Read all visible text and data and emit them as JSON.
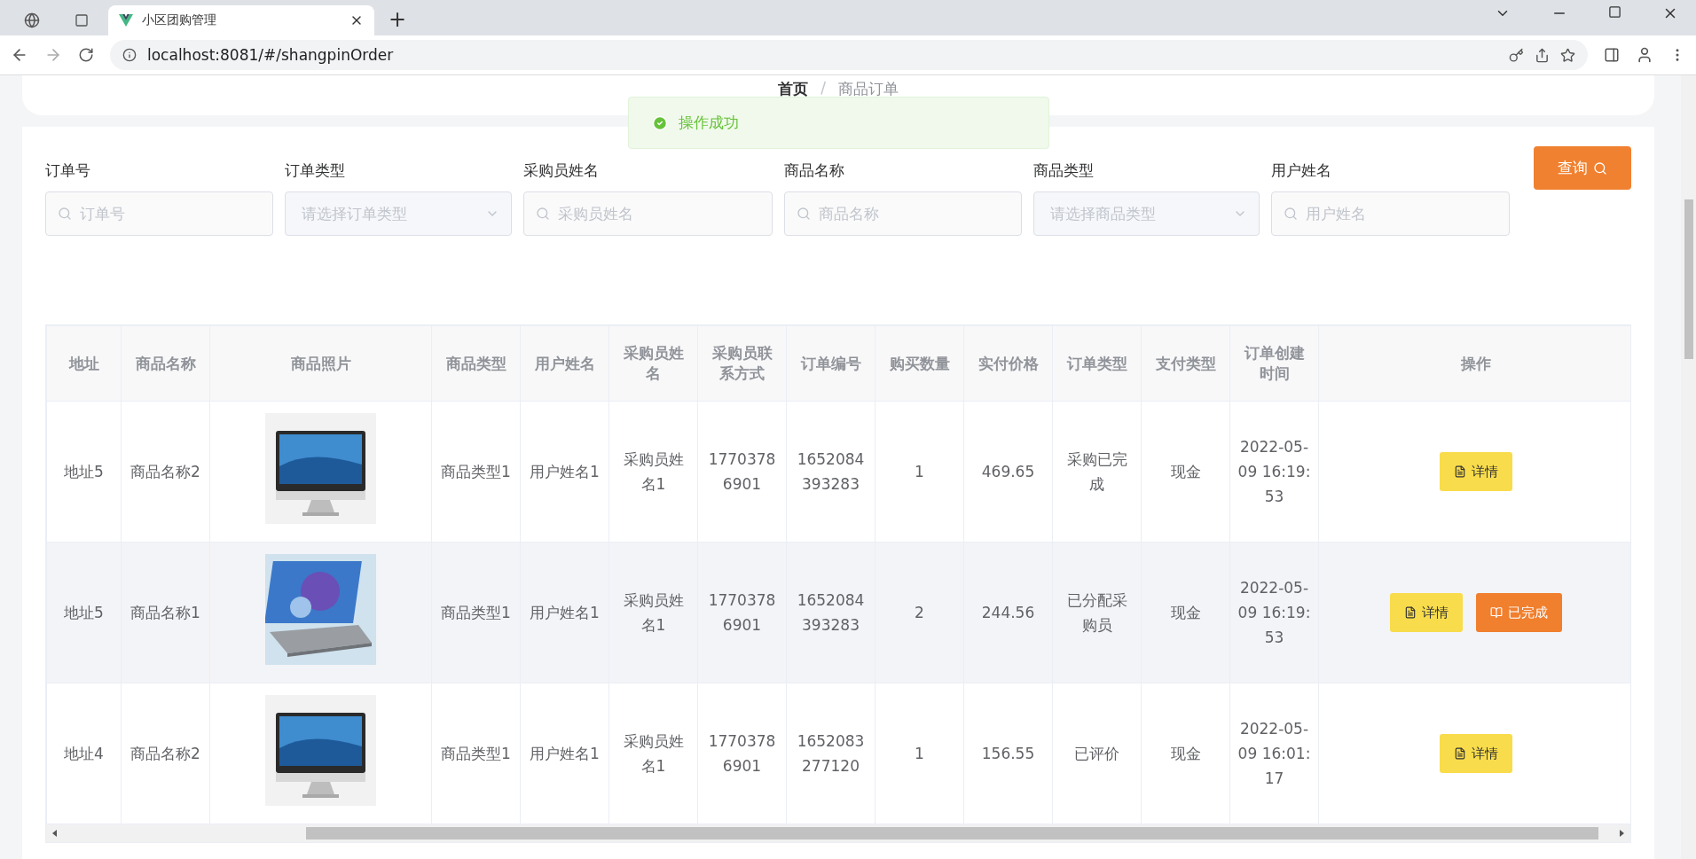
{
  "browser": {
    "tabs": [
      {
        "title": "小区团购管理",
        "selected": true
      }
    ],
    "new_tab": "+",
    "url": "localhost:8081/#/shangpinOrder"
  },
  "breadcrumb": {
    "items": [
      "首页",
      "商品订单"
    ],
    "separator": "/"
  },
  "toast": {
    "message": "操作成功"
  },
  "filters": [
    {
      "label": "订单号",
      "kind": "input",
      "placeholder": "订单号"
    },
    {
      "label": "订单类型",
      "kind": "select",
      "placeholder": "请选择订单类型"
    },
    {
      "label": "采购员姓名",
      "kind": "input",
      "placeholder": "采购员姓名"
    },
    {
      "label": "商品名称",
      "kind": "input",
      "placeholder": "商品名称"
    },
    {
      "label": "商品类型",
      "kind": "select",
      "placeholder": "请选择商品类型"
    },
    {
      "label": "用户姓名",
      "kind": "input",
      "placeholder": "用户姓名"
    }
  ],
  "search_button": "查询",
  "table": {
    "columns": [
      "地址",
      "商品名称",
      "商品照片",
      "商品类型",
      "用户姓名",
      "采购员姓名",
      "采购员联系方式",
      "订单编号",
      "购买数量",
      "实付价格",
      "订单类型",
      "支付类型",
      "订单创建时间",
      "操作"
    ],
    "rows": [
      {
        "hovered": false,
        "cells": [
          "地址5",
          "商品名称2",
          {
            "kind": "picture"
          },
          "商品类型1",
          "用户姓名1",
          "采购员姓名1",
          "17703786901",
          "1652084393283",
          "1",
          "469.65",
          "采购已完成",
          "现金",
          "2022-05-09 16:19:53"
        ],
        "actions": [
          {
            "kind": "detail",
            "label": "详情"
          }
        ]
      },
      {
        "hovered": true,
        "cells": [
          "地址5",
          "商品名称1",
          {
            "kind": "picture"
          },
          "商品类型1",
          "用户姓名1",
          "采购员姓名1",
          "17703786901",
          "1652084393283",
          "2",
          "244.56",
          "已分配采购员",
          "现金",
          "2022-05-09 16:19:53"
        ],
        "actions": [
          {
            "kind": "detail",
            "label": "详情"
          },
          {
            "kind": "done",
            "label": "已完成"
          }
        ]
      },
      {
        "hovered": false,
        "cells": [
          "地址4",
          "商品名称2",
          {
            "kind": "picture"
          },
          "商品类型1",
          "用户姓名1",
          "采购员姓名1",
          "17703786901",
          "1652083277120",
          "1",
          "156.55",
          "已评价",
          "现金",
          "2022-05-09 16:01:17"
        ],
        "actions": [
          {
            "kind": "detail",
            "label": "详情"
          }
        ]
      }
    ]
  }
}
